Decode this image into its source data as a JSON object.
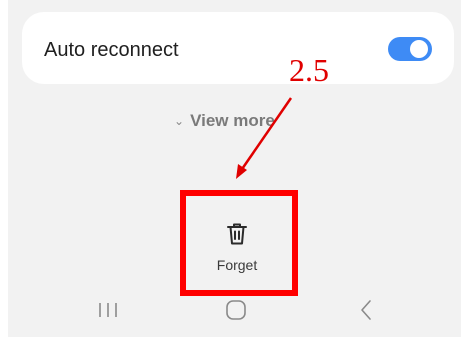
{
  "settings": {
    "auto_reconnect_label": "Auto reconnect",
    "auto_reconnect_enabled": true,
    "view_more_label": "View more"
  },
  "actions": {
    "forget_label": "Forget"
  },
  "annotation": {
    "step_label": "2.5"
  },
  "nav": {
    "recents": "recent-apps-icon",
    "home": "home-icon",
    "back": "back-icon"
  },
  "colors": {
    "toggle_on": "#3e8bf5",
    "annotation_red": "#ff0000",
    "screen_bg": "#f2f2f2"
  }
}
